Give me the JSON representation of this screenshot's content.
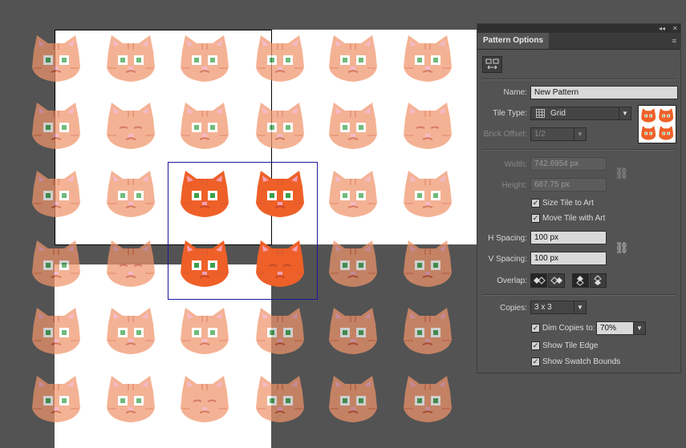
{
  "panel": {
    "title": "Pattern Options",
    "menu_glyph": "≡",
    "collapse_glyph": "◂◂",
    "close_glyph": "✕",
    "tool_icon": "tile-editor-icon",
    "name_label": "Name:",
    "name_value": "New Pattern",
    "tile_type_label": "Tile Type:",
    "tile_type_value": "Grid",
    "brick_offset_label": "Brick Offset:",
    "brick_offset_value": "1/2",
    "width_label": "Width:",
    "width_value": "742.6954 px",
    "height_label": "Height:",
    "height_value": "687.75 px",
    "size_tile_label": "Size Tile to Art",
    "move_tile_label": "Move Tile with Art",
    "h_spacing_label": "H Spacing:",
    "h_spacing_value": "100 px",
    "v_spacing_label": "V Spacing:",
    "v_spacing_value": "100 px",
    "overlap_label": "Overlap:",
    "copies_label": "Copies:",
    "copies_value": "3 x 3",
    "dim_copies_label": "Dim Copies to:",
    "dim_copies_value": "70%",
    "show_tile_edge_label": "Show Tile Edge",
    "show_swatch_bounds_label": "Show Swatch Bounds",
    "checkmark": "✓"
  },
  "colors": {
    "canvas_bg": "#535353",
    "cat_dim": "#f0956b",
    "cat_active": "#ee6028",
    "eye_green": "#3aa04a",
    "nose_pink": "#f2a0b4"
  }
}
